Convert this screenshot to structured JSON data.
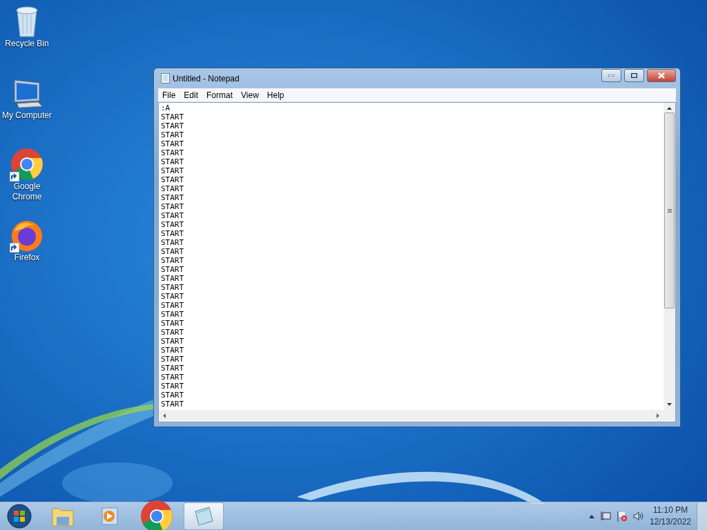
{
  "desktop_icons": [
    {
      "label": "Recycle Bin",
      "kind": "bin",
      "shortcut": false
    },
    {
      "label": "My Computer",
      "kind": "computer",
      "shortcut": false
    },
    {
      "label": "Google Chrome",
      "kind": "chrome",
      "shortcut": true
    },
    {
      "label": "Firefox",
      "kind": "firefox",
      "shortcut": true
    }
  ],
  "window": {
    "title": "Untitled - Notepad",
    "menu": [
      "File",
      "Edit",
      "Format",
      "View",
      "Help"
    ],
    "lines": [
      ":A",
      "START",
      "START",
      "START",
      "START",
      "START",
      "START",
      "START",
      "START",
      "START",
      "START",
      "START",
      "START",
      "START",
      "START",
      "START",
      "START",
      "START",
      "START",
      "START",
      "START",
      "START",
      "START",
      "START",
      "START",
      "START",
      "START",
      "START",
      "START",
      "START",
      "START",
      "START",
      "START",
      "START"
    ]
  },
  "taskbar": {
    "apps": [
      {
        "kind": "start",
        "selected": false
      },
      {
        "kind": "explorer",
        "selected": false
      },
      {
        "kind": "media",
        "selected": false
      },
      {
        "kind": "chrome",
        "selected": false
      },
      {
        "kind": "notepad",
        "selected": true
      }
    ],
    "time": "11:10 PM",
    "date": "12/13/2022"
  }
}
